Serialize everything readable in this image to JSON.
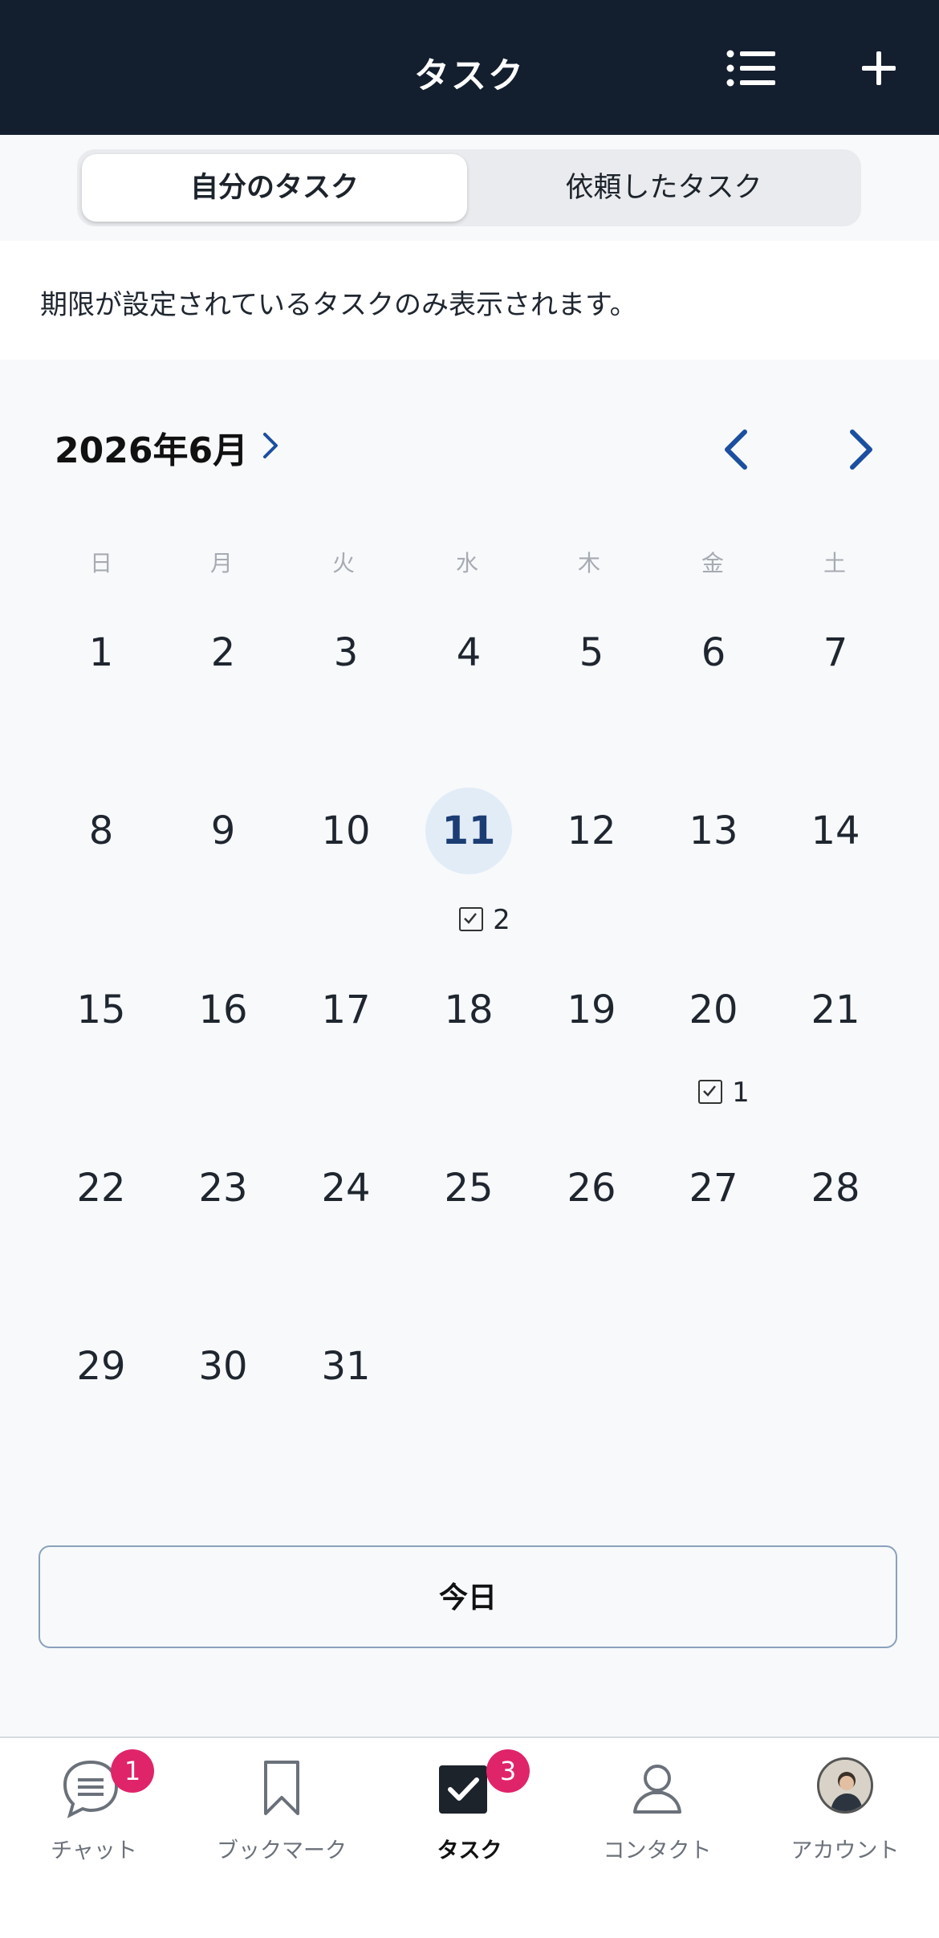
{
  "header": {
    "title": "タスク",
    "list_icon": "list-icon",
    "add_icon": "plus-icon"
  },
  "segment": {
    "active_label": "自分のタスク",
    "inactive_label": "依頼したタスク"
  },
  "notice": "期限が設定されているタスクのみ表示されます。",
  "calendar": {
    "month_label": "2026年6月",
    "weekdays": [
      "日",
      "月",
      "火",
      "水",
      "木",
      "金",
      "土"
    ],
    "days": [
      "1",
      "2",
      "3",
      "4",
      "5",
      "6",
      "7",
      "8",
      "9",
      "10",
      "11",
      "12",
      "13",
      "14",
      "15",
      "16",
      "17",
      "18",
      "19",
      "20",
      "21",
      "22",
      "23",
      "24",
      "25",
      "26",
      "27",
      "28",
      "29",
      "30",
      "31"
    ],
    "today": "11",
    "tasks": [
      {
        "day": "11",
        "count": "2"
      },
      {
        "day": "20",
        "count": "1"
      }
    ]
  },
  "today_button": "今日",
  "tabbar": {
    "items": [
      {
        "label": "チャット",
        "icon": "chat-icon",
        "badge": "1"
      },
      {
        "label": "ブックマーク",
        "icon": "bookmark-icon"
      },
      {
        "label": "タスク",
        "icon": "task-check-icon",
        "badge": "3"
      },
      {
        "label": "コンタクト",
        "icon": "person-icon"
      },
      {
        "label": "アカウント",
        "icon": "avatar"
      }
    ]
  },
  "colors": {
    "header_bg": "#131e2e",
    "accent": "#1b4fa0",
    "badge": "#e0246a",
    "today_highlight": "#e2ecf7"
  }
}
